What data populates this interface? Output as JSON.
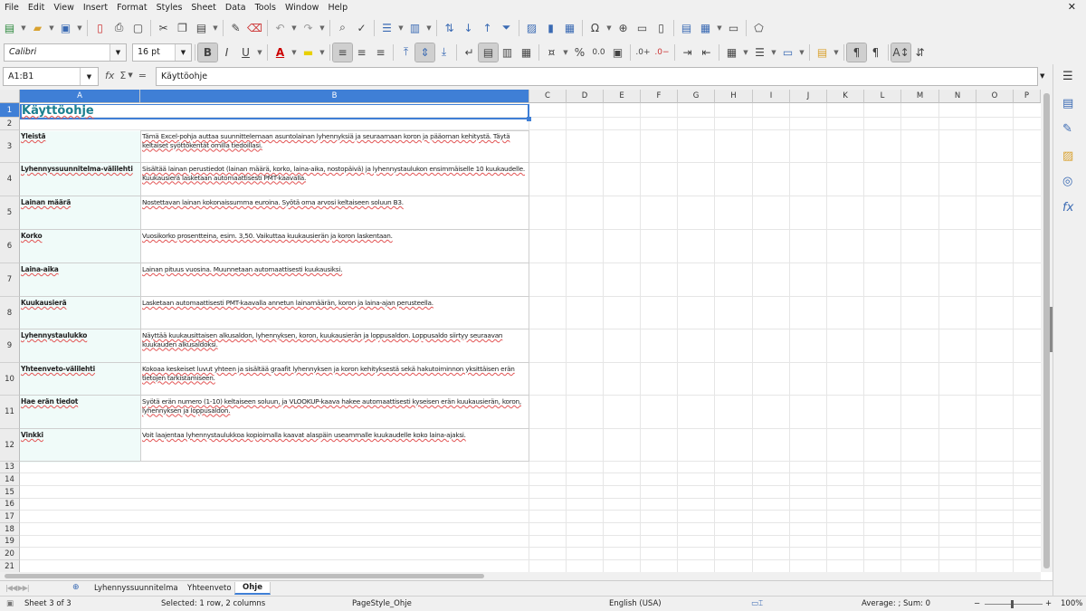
{
  "menu": [
    "File",
    "Edit",
    "View",
    "Insert",
    "Format",
    "Styles",
    "Sheet",
    "Data",
    "Tools",
    "Window",
    "Help"
  ],
  "close_glyph": "✕",
  "toolbar": {
    "font_name": "Calibri",
    "font_size": "16 pt",
    "bold": "B",
    "italic": "I",
    "underline": "U",
    "percent": "%",
    "decimal": "0.0"
  },
  "formula_bar": {
    "cell_ref": "A1:B1",
    "content": "Käyttöohje",
    "fx": "fx",
    "sum": "Σ",
    "eq": "="
  },
  "columns": [
    "A",
    "B",
    "C",
    "D",
    "E",
    "F",
    "G",
    "H",
    "I",
    "J",
    "K",
    "L",
    "M",
    "N",
    "O",
    "P"
  ],
  "rows": [
    "1",
    "2",
    "3",
    "4",
    "5",
    "6",
    "7",
    "8",
    "9",
    "10",
    "11",
    "12",
    "13",
    "14",
    "15",
    "16",
    "17",
    "18",
    "19",
    "20",
    "21"
  ],
  "title": "Käyttöohje",
  "entries": [
    {
      "label": "Yleistä",
      "text": "Tämä Excel-pohja auttaa suunnittelemaan asuntolainan lyhennyksiä ja seuraamaan koron ja pääoman kehitystä. Täytä keltaiset syöttökentät omilla tiedoillasi."
    },
    {
      "label": "Lyhennyssuunnitelma-välilehti",
      "text": "Sisältää lainan perustiedot (lainan määrä, korko, laina-aika, nostopäivä) ja lyhennystaulukon ensimmäiselle 10 kuukaudelle. Kuukausierä lasketaan automaattisesti PMT-kaavalla."
    },
    {
      "label": "Lainan määrä",
      "text": "Nostettavan lainan kokonaissumma euroina. Syötä oma arvosi keltaiseen soluun B3."
    },
    {
      "label": "Korko",
      "text": "Vuosikorko prosentteina, esim. 3,50. Vaikuttaa kuukausierän ja koron laskentaan."
    },
    {
      "label": "Laina-aika",
      "text": "Lainan pituus vuosina. Muunnetaan automaattisesti kuukausiksi."
    },
    {
      "label": "Kuukausierä",
      "text": "Lasketaan automaattisesti PMT-kaavalla annetun lainamäärän, koron ja laina-ajan perusteella."
    },
    {
      "label": "Lyhennystaulukko",
      "text": "Näyttää kuukausittaisen alkusaldon, lyhennyksen, koron, kuukausierän ja loppusaldon. Loppusaldo siirtyy seuraavan kuukauden alkusaldoksi."
    },
    {
      "label": "Yhteenveto-välilehti",
      "text": "Kokoaa keskeiset luvut yhteen ja sisältää graafit lyhennyksen ja koron kehityksestä sekä hakutoiminnon yksittäisen erän tietojen tarkistamiseen."
    },
    {
      "label": "Hae erän tiedot",
      "text": "Syötä erän numero (1-10) keltaiseen soluun, ja VLOOKUP-kaava hakee automaattisesti kyseisen erän kuukausierän, koron, lyhennyksen ja loppusaldon."
    },
    {
      "label": "Vinkki",
      "text": "Voit laajentaa lyhennystaulukkoa kopioimalla kaavat alaspäin useammalle kuukaudelle koko laina-ajaksi."
    }
  ],
  "tabs": [
    "Lyhennyssuunnitelma",
    "Yhteenveto",
    "Ohje"
  ],
  "active_tab": "Ohje",
  "status": {
    "sheet": "Sheet 3 of 3",
    "selection": "Selected: 1 row, 2 columns",
    "page_style": "PageStyle_Ohje",
    "language": "English (USA)",
    "summary": "Average: ; Sum: 0",
    "zoom": "100%"
  },
  "colors": {
    "accent": "#3f7fd6",
    "title": "#1a7f8f",
    "label_fill": "#f0fbf9",
    "spell": "#e25454"
  }
}
